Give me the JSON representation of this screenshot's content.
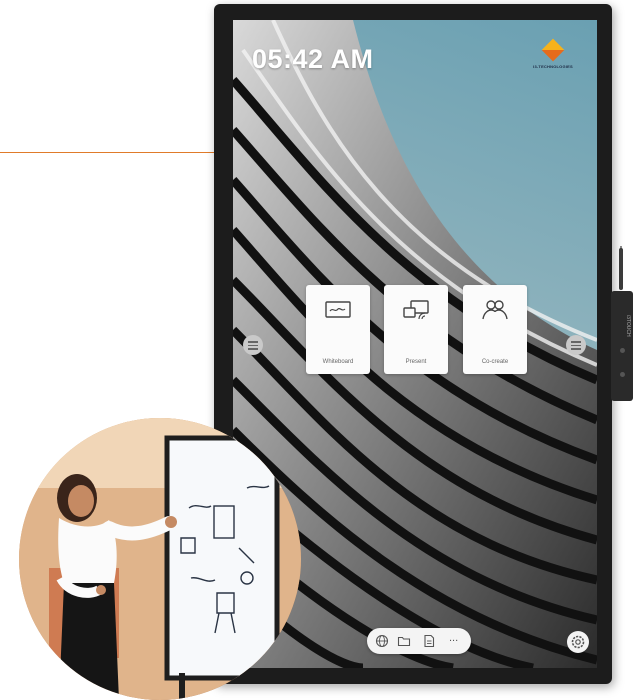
{
  "screen": {
    "clock": "05:42 AM",
    "brand_name": "I3-TECHNOLOGIES"
  },
  "tiles": [
    {
      "label": "Whiteboard",
      "icon": "whiteboard-icon"
    },
    {
      "label": "Present",
      "icon": "present-icon"
    },
    {
      "label": "Co-create",
      "icon": "co-create-icon"
    }
  ],
  "dock": {
    "items": [
      "globe-icon",
      "folder-icon",
      "document-icon",
      "more-icon"
    ],
    "more_label": "..."
  },
  "pen_clip": {
    "label": "i3TOUCH"
  },
  "colors": {
    "callout": "#e07b2a",
    "bezel": "#1c1c1c",
    "sky": "#6aa0b2"
  }
}
